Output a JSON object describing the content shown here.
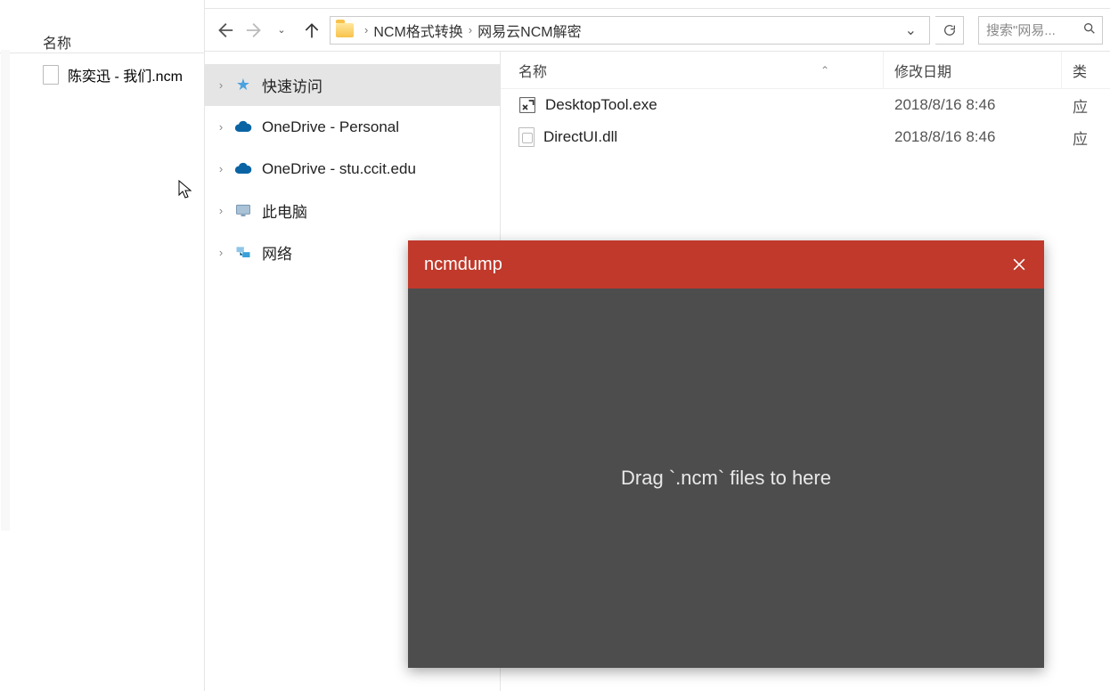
{
  "left_window": {
    "header_name": "名称",
    "file_name": "陈奕迅 - 我们.ncm"
  },
  "explorer": {
    "breadcrumb": {
      "seg1": "NCM格式转换",
      "seg2": "网易云NCM解密"
    },
    "search_placeholder": "搜索\"网易...",
    "nav": {
      "quick_access": "快速访问",
      "onedrive_personal": "OneDrive - Personal",
      "onedrive_edu": "OneDrive - stu.ccit.edu",
      "this_pc": "此电脑",
      "network": "网络"
    },
    "columns": {
      "name": "名称",
      "date": "修改日期",
      "type": "类"
    },
    "files": [
      {
        "name": "DesktopTool.exe",
        "date": "2018/8/16 8:46",
        "type": "应"
      },
      {
        "name": "DirectUI.dll",
        "date": "2018/8/16 8:46",
        "type": "应"
      }
    ]
  },
  "ncmdump": {
    "title": "ncmdump",
    "hint": "Drag `.ncm` files to here"
  }
}
